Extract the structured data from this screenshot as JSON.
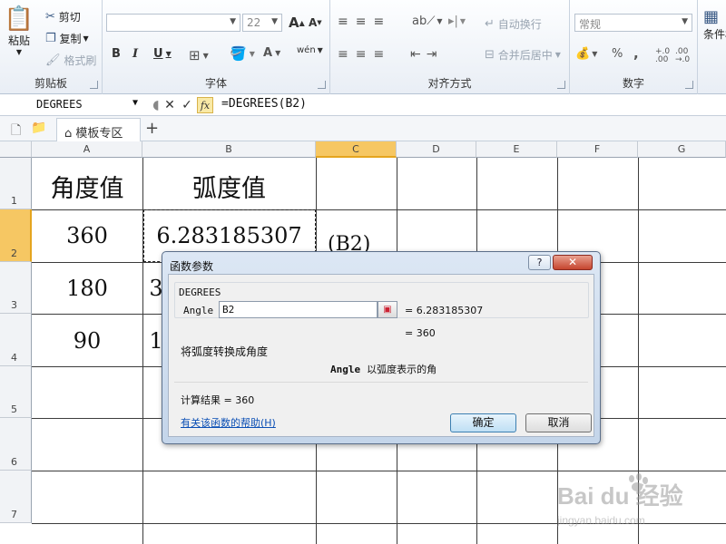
{
  "ribbon": {
    "clipboard": {
      "paste_label": "粘贴",
      "cut_label": "剪切",
      "copy_label": "复制",
      "format_painter_label": "格式刷",
      "group_label": "剪贴板"
    },
    "font": {
      "font_size": "22",
      "grow_glyph": "A",
      "shrink_glyph": "A",
      "bold_glyph": "B",
      "italic_glyph": "I",
      "underline_glyph": "U",
      "font_color_glyph": "A",
      "phonetic_glyph": "wén",
      "group_label": "字体"
    },
    "alignment": {
      "wrap_label": "自动换行",
      "merge_label": "合并后居中",
      "group_label": "对齐方式"
    },
    "number": {
      "format_value": "常规",
      "percent_glyph": "%",
      "comma_glyph": ",",
      "inc_decimal": "+.0 .00",
      "dec_decimal": ".00 →.0",
      "group_label": "数字"
    },
    "styles": {
      "conditional_label": "条件格式"
    }
  },
  "formula_bar": {
    "name_box": "DEGREES",
    "cancel_glyph": "✕",
    "enter_glyph": "✓",
    "fx_label": "fx",
    "formula": "=DEGREES(B2)"
  },
  "tabs": {
    "template_tab": "模板专区",
    "add_glyph": "+"
  },
  "sheet": {
    "columns": [
      "A",
      "B",
      "C",
      "D",
      "E",
      "F",
      "G"
    ],
    "selected_column": "C",
    "rows": [
      "1",
      "2",
      "3",
      "4",
      "5",
      "6",
      "7"
    ],
    "selected_row": "2",
    "cells": {
      "A1": "角度值",
      "B1": "弧度值",
      "A2": "360",
      "B2": "6.283185307",
      "C2": "(B2)",
      "A3": "180",
      "B3": "3",
      "A4": "90",
      "B4": "1"
    }
  },
  "dialog": {
    "title": "函数参数",
    "help_glyph": "?",
    "close_glyph": "✕",
    "function_name": "DEGREES",
    "arg_label": "Angle",
    "arg_value": "B2",
    "arg_result": "= 6.283185307",
    "fn_result": "= 360",
    "description": "将弧度转换成角度",
    "arg_name_bold": "Angle",
    "arg_description": "以弧度表示的角",
    "calc_result": "计算结果 =  360",
    "help_link": "有关该函数的帮助(H)",
    "ok_label": "确定",
    "cancel_label": "取消"
  },
  "watermark": {
    "text": "Bai du 经验",
    "url": "jingyan.baidu.com"
  }
}
